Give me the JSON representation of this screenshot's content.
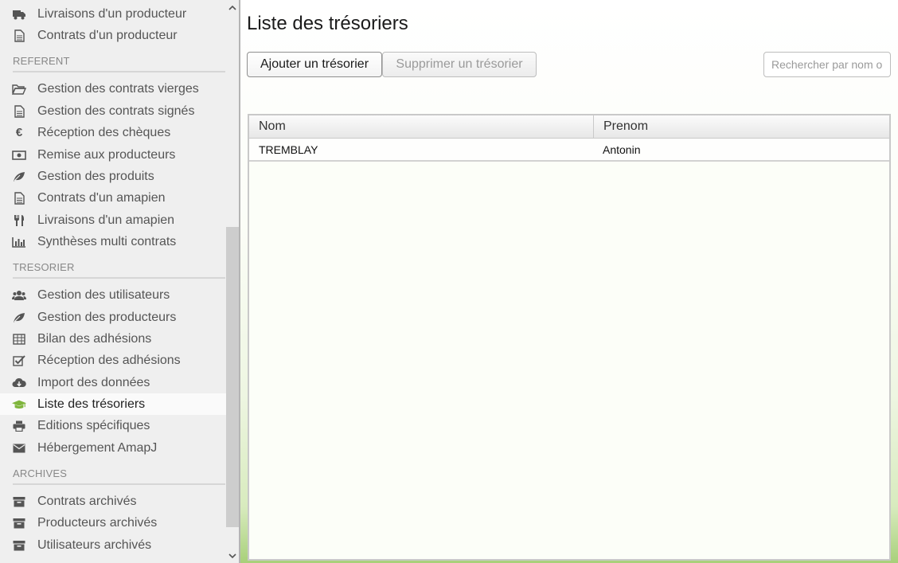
{
  "sidebar": {
    "top_items": [
      {
        "label": "Livraisons d'un producteur",
        "icon": "truck-icon"
      },
      {
        "label": "Contrats d'un producteur",
        "icon": "file-icon"
      }
    ],
    "sections": [
      {
        "title": "REFERENT",
        "items": [
          {
            "label": "Gestion des contrats vierges",
            "icon": "folder-open-icon"
          },
          {
            "label": "Gestion des contrats signés",
            "icon": "file-icon"
          },
          {
            "label": "Réception des chèques",
            "icon": "euro-icon"
          },
          {
            "label": "Remise aux producteurs",
            "icon": "money-icon"
          },
          {
            "label": "Gestion des produits",
            "icon": "leaf-icon"
          },
          {
            "label": "Contrats d'un amapien",
            "icon": "file-icon"
          },
          {
            "label": "Livraisons d'un amapien",
            "icon": "cutlery-icon"
          },
          {
            "label": "Synthèses multi contrats",
            "icon": "bar-chart-icon"
          }
        ]
      },
      {
        "title": "TRESORIER",
        "items": [
          {
            "label": "Gestion des utilisateurs",
            "icon": "users-icon"
          },
          {
            "label": "Gestion des producteurs",
            "icon": "leaf-icon"
          },
          {
            "label": "Bilan des adhésions",
            "icon": "table-icon"
          },
          {
            "label": "Réception des adhésions",
            "icon": "check-square-icon"
          },
          {
            "label": "Import des données",
            "icon": "cloud-download-icon"
          },
          {
            "label": "Liste des trésoriers",
            "icon": "graduation-cap-icon",
            "active": true
          },
          {
            "label": "Editions spécifiques",
            "icon": "print-icon"
          },
          {
            "label": "Hébergement AmapJ",
            "icon": "envelope-icon"
          }
        ]
      },
      {
        "title": "ARCHIVES",
        "items": [
          {
            "label": "Contrats archivés",
            "icon": "archive-icon"
          },
          {
            "label": "Producteurs archivés",
            "icon": "archive-icon"
          },
          {
            "label": "Utilisateurs archivés",
            "icon": "archive-icon"
          }
        ]
      }
    ]
  },
  "main": {
    "title": "Liste des trésoriers",
    "add_button": "Ajouter un trésorier",
    "delete_button": "Supprimer un trésorier",
    "search_placeholder": "Rechercher par nom ou prénom",
    "table": {
      "columns": [
        "Nom",
        "Prenom"
      ],
      "rows": [
        {
          "nom": "TREMBLAY",
          "prenom": "Antonin"
        }
      ]
    }
  },
  "colors": {
    "accent": "#7fb53c",
    "sidebar_bg": "#efefef"
  }
}
